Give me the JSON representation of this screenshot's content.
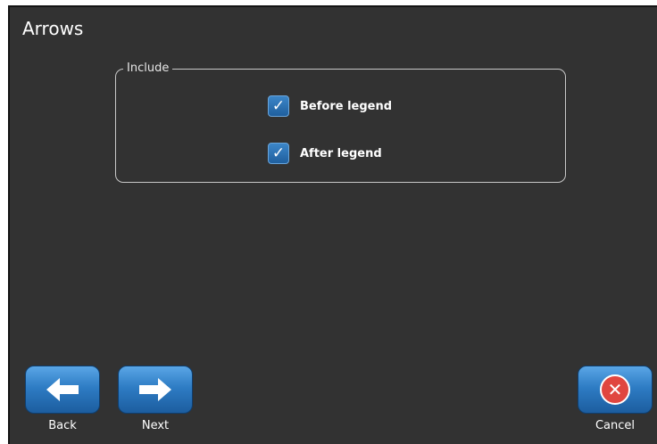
{
  "window": {
    "title": "Arrows"
  },
  "include_group": {
    "legend": "Include",
    "options": [
      {
        "label": "Before legend",
        "checked": true
      },
      {
        "label": "After legend",
        "checked": true
      }
    ]
  },
  "footer": {
    "back_label": "Back",
    "next_label": "Next",
    "cancel_label": "Cancel"
  },
  "icons": {
    "back": "arrow-left-icon",
    "next": "arrow-right-icon",
    "cancel": "close-icon",
    "check": "check-icon"
  },
  "colors": {
    "screen_background": "#323232",
    "button_blue": "#2e7cc4",
    "cancel_red": "#e0463f",
    "checkbox_blue": "#2e75b8"
  }
}
